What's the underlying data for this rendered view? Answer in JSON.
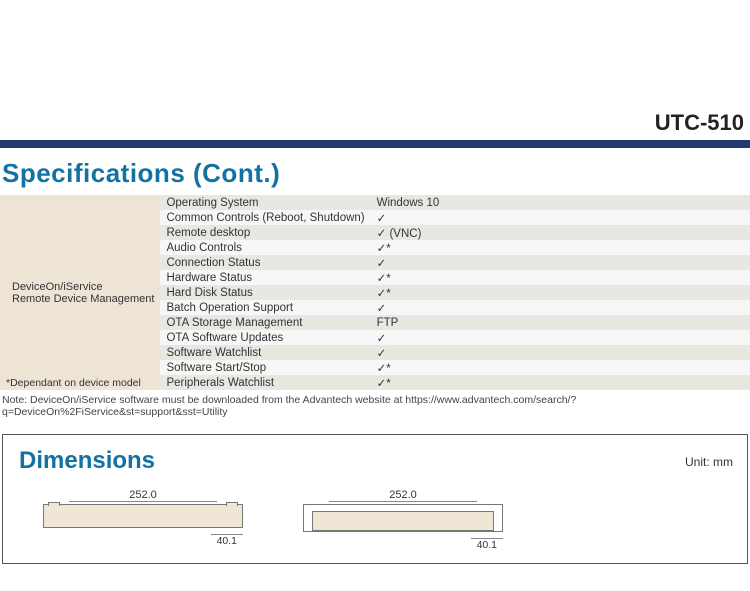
{
  "header": {
    "product": "UTC-510"
  },
  "sections": {
    "specs_title": "Specifications (Cont.)",
    "dims_title": "Dimensions",
    "dims_unit": "Unit: mm"
  },
  "spec_category": {
    "line1": "DeviceOn/iService",
    "line2": "Remote Device Management",
    "note": "*Dependant on device model"
  },
  "spec_rows": [
    {
      "feature": "Operating System",
      "value": "Windows 10"
    },
    {
      "feature": "Common Controls (Reboot, Shutdown)",
      "value": "✓"
    },
    {
      "feature": "Remote desktop",
      "value": "✓ (VNC)"
    },
    {
      "feature": "Audio Controls",
      "value": "✓*"
    },
    {
      "feature": "Connection Status",
      "value": "✓"
    },
    {
      "feature": "Hardware Status",
      "value": "✓*"
    },
    {
      "feature": "Hard Disk Status",
      "value": "✓*"
    },
    {
      "feature": "Batch Operation Support",
      "value": "✓"
    },
    {
      "feature": "OTA Storage Management",
      "value": "FTP"
    },
    {
      "feature": "OTA Software Updates",
      "value": "✓"
    },
    {
      "feature": "Software Watchlist",
      "value": "✓"
    },
    {
      "feature": "Software Start/Stop",
      "value": "✓*"
    },
    {
      "feature": "Peripherals Watchlist",
      "value": "✓*"
    }
  ],
  "footnote": "Note: DeviceOn/iService software must be downloaded from the Advantech website at https://www.advantech.com/search/?q=DeviceOn%2FiService&st=support&sst=Utility",
  "dimensions": {
    "width_label": "252.0",
    "depth_label": "40.1"
  }
}
